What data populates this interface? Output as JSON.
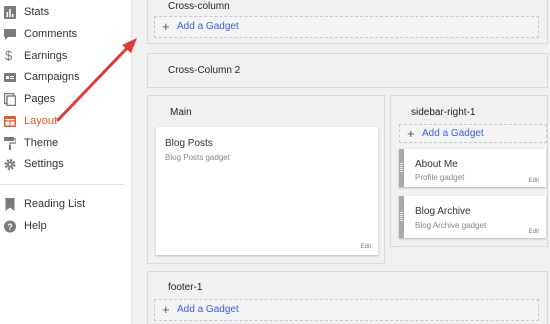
{
  "sidebar": {
    "items": [
      {
        "label": "Stats",
        "icon": "stats-icon"
      },
      {
        "label": "Comments",
        "icon": "comments-icon"
      },
      {
        "label": "Earnings",
        "icon": "dollar-icon"
      },
      {
        "label": "Campaigns",
        "icon": "campaigns-icon"
      },
      {
        "label": "Pages",
        "icon": "pages-icon"
      },
      {
        "label": "Layout",
        "icon": "layout-icon",
        "active": true
      },
      {
        "label": "Theme",
        "icon": "paint-roller-icon"
      },
      {
        "label": "Settings",
        "icon": "gear-icon"
      }
    ],
    "secondary": [
      {
        "label": "Reading List",
        "icon": "bookmark-icon"
      },
      {
        "label": "Help",
        "icon": "help-icon"
      }
    ]
  },
  "layout": {
    "cross_column": {
      "title": "Cross-column",
      "add_label": "Add a Gadget"
    },
    "cross_column_2": {
      "title": "Cross-Column 2"
    },
    "main": {
      "title": "Main",
      "gadget": {
        "title": "Blog Posts",
        "subtitle": "Blog Posts gadget",
        "edit": "Edit"
      }
    },
    "sidebar_right": {
      "title": "sidebar-right-1",
      "add_label": "Add a Gadget",
      "gadgets": [
        {
          "title": "About Me",
          "subtitle": "Profile gadget",
          "edit": "Edit"
        },
        {
          "title": "Blog Archive",
          "subtitle": "Blog Archive gadget",
          "edit": "Edit"
        }
      ]
    },
    "footer": {
      "title": "footer-1",
      "add_label": "Add a Gadget"
    }
  },
  "colors": {
    "accent": "#e25b2c",
    "link": "#3367d6",
    "arrow": "#e53935"
  }
}
